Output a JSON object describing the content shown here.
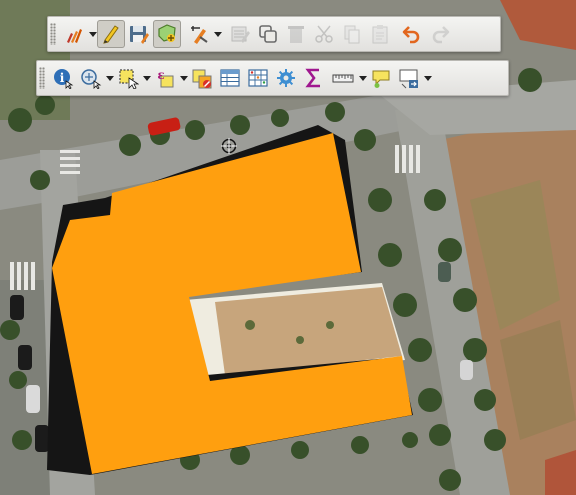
{
  "colors": {
    "polygon_fill": "#ff9f0f",
    "polygon_outline": "#151515",
    "courtyard_sand": "#c7a57c",
    "courtyard_pavement": "#efece0",
    "road": "#9c9d98",
    "tree_canopy": "#38502a",
    "field": "#a9815e",
    "toolbar_bg": "#ebeae6",
    "active_button_bg": "#cfcdc6"
  },
  "toolbars": {
    "editing": {
      "buttons": [
        {
          "icon": "digitize-pencils-icon",
          "has_dropdown": true,
          "state": "normal"
        },
        {
          "icon": "toggle-editing-pencil-icon",
          "has_dropdown": false,
          "state": "active"
        },
        {
          "icon": "save-layer-edits-icon",
          "has_dropdown": false,
          "state": "normal"
        },
        {
          "icon": "add-polygon-feature-icon",
          "has_dropdown": false,
          "state": "active"
        },
        {
          "icon": "vertex-tool-icon",
          "has_dropdown": true,
          "state": "normal"
        },
        {
          "icon": "modify-attributes-icon",
          "has_dropdown": false,
          "state": "disabled"
        },
        {
          "icon": "copy-features-icon",
          "has_dropdown": false,
          "state": "normal"
        },
        {
          "icon": "delete-selected-icon",
          "has_dropdown": false,
          "state": "disabled"
        },
        {
          "icon": "cut-features-icon",
          "has_dropdown": false,
          "state": "disabled"
        },
        {
          "icon": "copy-icon",
          "has_dropdown": false,
          "state": "disabled"
        },
        {
          "icon": "paste-features-icon",
          "has_dropdown": false,
          "state": "disabled"
        },
        {
          "icon": "undo-icon",
          "has_dropdown": false,
          "state": "normal"
        },
        {
          "icon": "redo-icon",
          "has_dropdown": false,
          "state": "disabled"
        }
      ]
    },
    "attributes": {
      "buttons": [
        {
          "icon": "identify-features-icon",
          "has_dropdown": false,
          "state": "normal"
        },
        {
          "icon": "run-feature-action-icon",
          "has_dropdown": true,
          "state": "normal"
        },
        {
          "icon": "select-features-icon",
          "has_dropdown": true,
          "state": "normal"
        },
        {
          "icon": "select-by-expression-icon",
          "has_dropdown": true,
          "state": "normal"
        },
        {
          "icon": "deselect-all-icon",
          "has_dropdown": false,
          "state": "normal"
        },
        {
          "icon": "open-attribute-table-icon",
          "has_dropdown": false,
          "state": "normal"
        },
        {
          "icon": "field-calculator-icon",
          "has_dropdown": false,
          "state": "normal"
        },
        {
          "icon": "toolbox-gear-icon",
          "has_dropdown": false,
          "state": "normal"
        },
        {
          "icon": "statistical-summary-sigma-icon",
          "has_dropdown": false,
          "state": "normal"
        },
        {
          "icon": "measure-line-icon",
          "has_dropdown": true,
          "state": "normal"
        },
        {
          "icon": "map-tips-icon",
          "has_dropdown": false,
          "state": "normal"
        },
        {
          "icon": "new-annotation-icon",
          "has_dropdown": true,
          "state": "normal"
        }
      ]
    }
  }
}
